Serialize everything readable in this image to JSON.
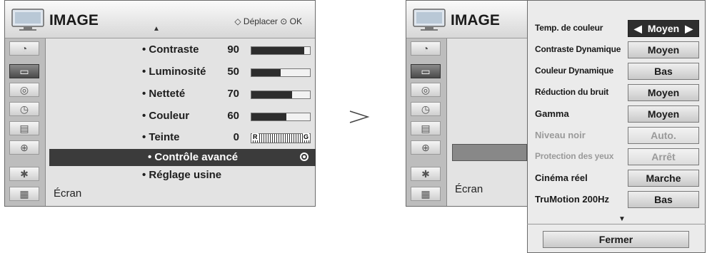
{
  "left_menu": {
    "title": "IMAGE",
    "hint": "Déplacer ⊙ OK",
    "items": [
      {
        "label": "• Contraste",
        "value": "90",
        "level": 0.9
      },
      {
        "label": "• Luminosité",
        "value": "50",
        "level": 0.5
      },
      {
        "label": "• Netteté",
        "value": "70",
        "level": 0.7
      },
      {
        "label": "• Couleur",
        "value": "60",
        "level": 0.6
      }
    ],
    "tint": {
      "label": "• Teinte",
      "value": "0",
      "left": "R",
      "right": "G"
    },
    "selected": "• Contrôle avancé",
    "reset": "• Réglage usine",
    "footer": "Écran"
  },
  "right_menu": {
    "title": "IMAGE",
    "footer": "Écran"
  },
  "submenu": {
    "rows": [
      {
        "label": "Temp. de couleur",
        "value": "Moyen",
        "state": "active"
      },
      {
        "label": "Contraste Dynamique",
        "value": "Moyen",
        "state": "normal"
      },
      {
        "label": "Couleur Dynamique",
        "value": "Bas",
        "state": "normal"
      },
      {
        "label": "Réduction du bruit",
        "value": "Moyen",
        "state": "normal"
      },
      {
        "label": "Gamma",
        "value": "Moyen",
        "state": "normal"
      },
      {
        "label": "Niveau noir",
        "value": "Auto.",
        "state": "disabled"
      },
      {
        "label": "Protection des yeux",
        "value": "Arrêt",
        "state": "disabled"
      },
      {
        "label": "Cinéma réel",
        "value": "Marche",
        "state": "normal"
      },
      {
        "label": "TruMotion 200Hz",
        "value": "Bas",
        "state": "normal"
      }
    ],
    "close": "Fermer"
  }
}
